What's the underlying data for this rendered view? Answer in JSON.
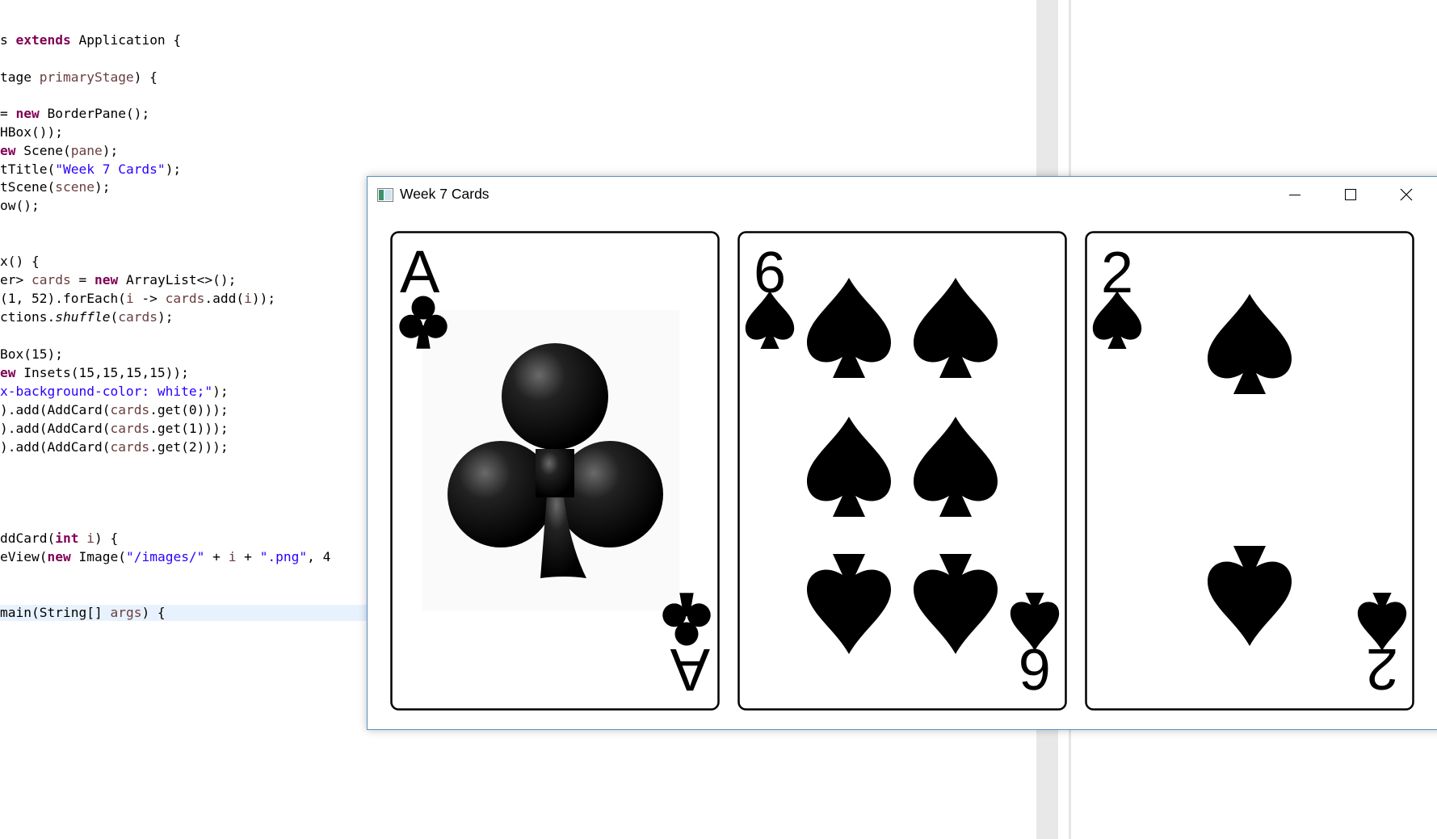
{
  "editor": {
    "lines": [
      [
        {
          "t": "s "
        },
        {
          "t": "extends",
          "c": "kw"
        },
        {
          "t": " Application {"
        }
      ],
      [
        {
          "t": "tage "
        },
        {
          "t": "primaryStage",
          "c": "var"
        },
        {
          "t": ") {"
        }
      ],
      [
        {
          "t": "= "
        },
        {
          "t": "new",
          "c": "kw"
        },
        {
          "t": " BorderPane();"
        }
      ],
      [
        {
          "t": "HBox());"
        }
      ],
      [
        {
          "t": "ew",
          "c": "kw"
        },
        {
          "t": " Scene("
        },
        {
          "t": "pane",
          "c": "var"
        },
        {
          "t": ");"
        }
      ],
      [
        {
          "t": "tTitle("
        },
        {
          "t": "\"Week 7 Cards\"",
          "c": "str"
        },
        {
          "t": ");"
        }
      ],
      [
        {
          "t": "tScene("
        },
        {
          "t": "scene",
          "c": "var"
        },
        {
          "t": ");"
        }
      ],
      [
        {
          "t": "ow();"
        }
      ],
      [
        {
          "t": "x() {"
        }
      ],
      [
        {
          "t": "er> "
        },
        {
          "t": "cards",
          "c": "var"
        },
        {
          "t": " = "
        },
        {
          "t": "new",
          "c": "kw"
        },
        {
          "t": " ArrayList<>();"
        }
      ],
      [
        {
          "t": "(1, 52).forEach("
        },
        {
          "t": "i",
          "c": "var"
        },
        {
          "t": " -> "
        },
        {
          "t": "cards",
          "c": "var"
        },
        {
          "t": ".add("
        },
        {
          "t": "i",
          "c": "var"
        },
        {
          "t": "));"
        }
      ],
      [
        {
          "t": "ctions."
        },
        {
          "t": "shuffle",
          "c": "it"
        },
        {
          "t": "("
        },
        {
          "t": "cards",
          "c": "var"
        },
        {
          "t": ");"
        }
      ],
      [
        {
          "t": "Box(15);"
        }
      ],
      [
        {
          "t": "ew",
          "c": "kw"
        },
        {
          "t": " Insets(15,15,15,15));"
        }
      ],
      [
        {
          "t": "x-background-color: white;\"",
          "c": "str"
        },
        {
          "t": ");"
        }
      ],
      [
        {
          "t": ").add(AddCard("
        },
        {
          "t": "cards",
          "c": "var"
        },
        {
          "t": ".get(0)));"
        }
      ],
      [
        {
          "t": ").add(AddCard("
        },
        {
          "t": "cards",
          "c": "var"
        },
        {
          "t": ".get(1)));"
        }
      ],
      [
        {
          "t": ").add(AddCard("
        },
        {
          "t": "cards",
          "c": "var"
        },
        {
          "t": ".get(2)));"
        }
      ],
      [
        {
          "t": "ddCard("
        },
        {
          "t": "int",
          "c": "kw"
        },
        {
          "t": " "
        },
        {
          "t": "i",
          "c": "var"
        },
        {
          "t": ") {"
        }
      ],
      [
        {
          "t": "eView("
        },
        {
          "t": "new",
          "c": "kw"
        },
        {
          "t": " Image("
        },
        {
          "t": "\"/images/\"",
          "c": "str"
        },
        {
          "t": " + "
        },
        {
          "t": "i",
          "c": "var"
        },
        {
          "t": " + "
        },
        {
          "t": "\".png\"",
          "c": "str"
        },
        {
          "t": ", 4"
        }
      ],
      [
        {
          "t": "main(String[] "
        },
        {
          "t": "args",
          "c": "var"
        },
        {
          "t": ") {"
        }
      ]
    ]
  },
  "window": {
    "title": "Week 7 Cards",
    "icon": "javafx-window-icon",
    "controls": [
      "minimize-icon",
      "maximize-icon",
      "close-icon"
    ]
  },
  "cards": [
    {
      "rank": "A",
      "suit": "clubs",
      "suit_symbol": "♣"
    },
    {
      "rank": "6",
      "suit": "spades",
      "suit_symbol": "♠"
    },
    {
      "rank": "2",
      "suit": "spades",
      "suit_symbol": "♠"
    }
  ]
}
